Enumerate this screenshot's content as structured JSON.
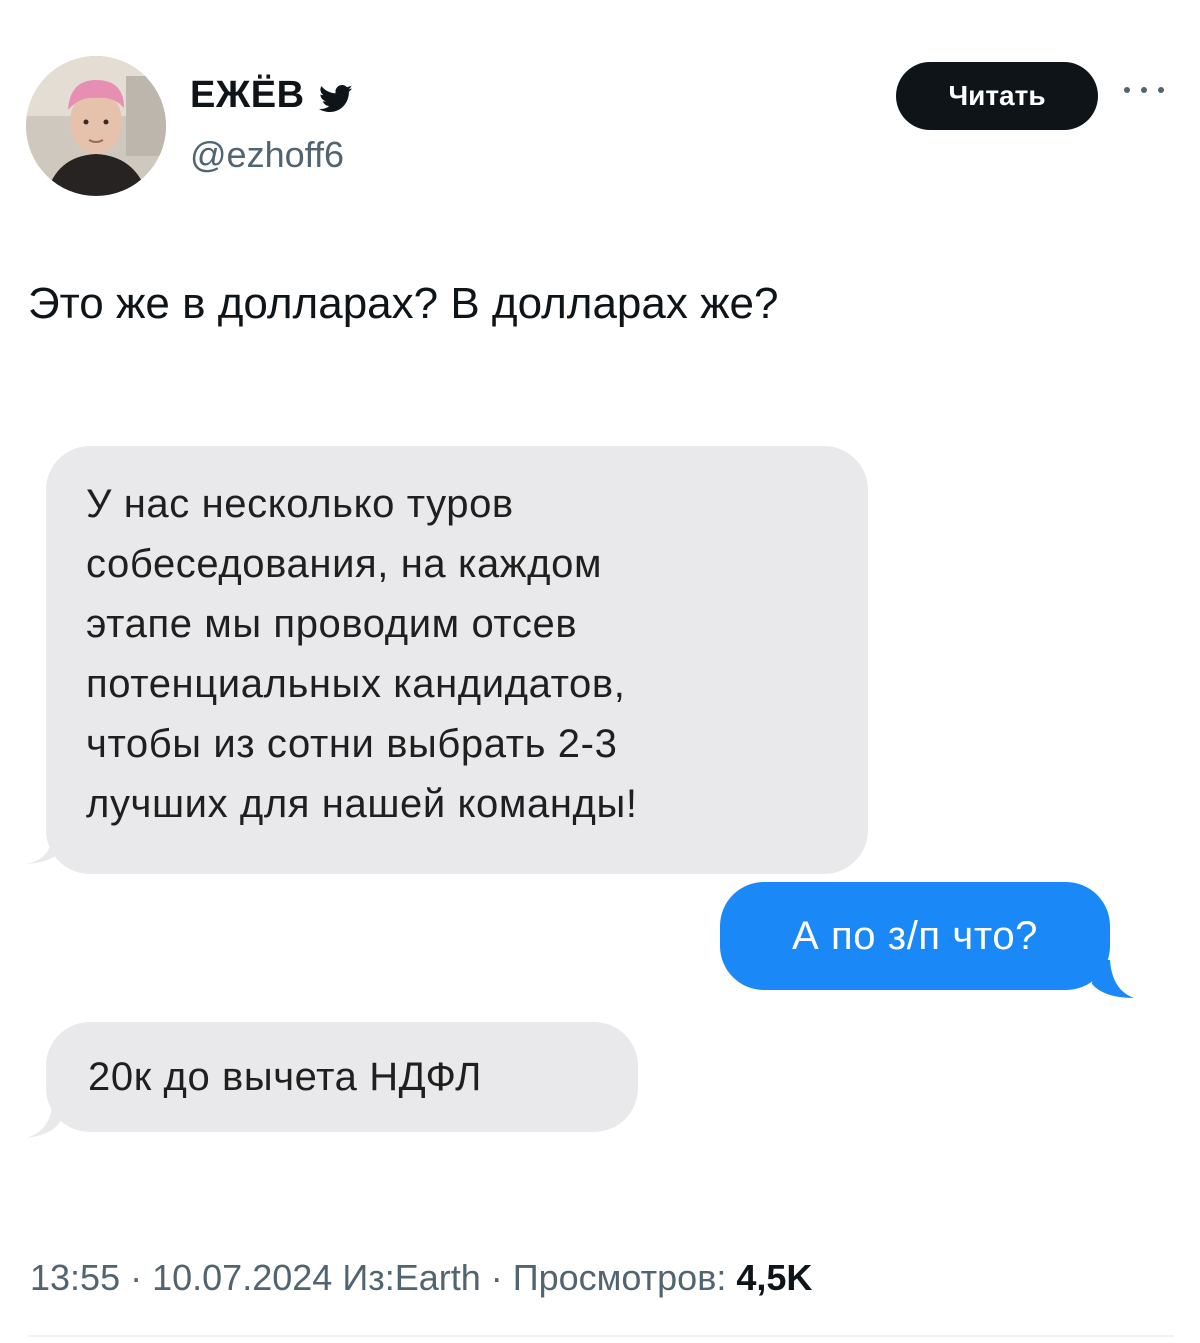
{
  "author": {
    "display_name": "ЕЖЁВ",
    "handle": "@ezhoff6",
    "verified_icon": "twitter-bird-icon"
  },
  "header": {
    "follow_label": "Читать",
    "more_icon": "more-horizontal-icon"
  },
  "tweet": {
    "text": "Это же в долларах? В долларах же?"
  },
  "chat": {
    "incoming_color": "#e9e9eb",
    "outgoing_color": "#1a88f7",
    "messages": [
      {
        "side": "incoming",
        "lines": [
          "У нас несколько туров",
          "собеседования, на каждом",
          "этапе мы проводим отсев",
          "потенциальных кандидатов,",
          "чтобы из сотни выбрать 2-3",
          "лучших для нашей команды!"
        ]
      },
      {
        "side": "outgoing",
        "text": "А по з/п что?"
      },
      {
        "side": "incoming",
        "text": "20к до вычета НДФЛ"
      }
    ]
  },
  "meta": {
    "time": "13:55",
    "date": "10.07.2024",
    "source": "Из:Earth",
    "views_label": "Просмотров:",
    "views_count": "4,5K"
  }
}
